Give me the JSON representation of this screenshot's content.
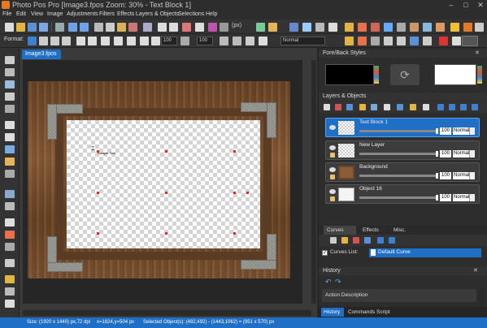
{
  "window": {
    "title": "Photo Pos Pro [Image3.fpos Zoom: 30% - Text Block 1]",
    "controls": {
      "minimize": "–",
      "maximize": "□",
      "close": "✕"
    }
  },
  "menu": [
    "File",
    "Edit",
    "View",
    "Image",
    "Adjustments",
    "Filters",
    "Effects",
    "Layers & Objects",
    "Selections",
    "Help"
  ],
  "toolbar": {
    "units": "(px)",
    "format_label": "Format:",
    "opacity_1": "100",
    "opacity_2": "100",
    "blend_mode": "Normal"
  },
  "document": {
    "tab": "Image3.fpos"
  },
  "canvas": {
    "text_block_preview": "Sample Text"
  },
  "status": {
    "size": "Size: (1920 x 1440) px,72 dpi",
    "coords": "x=1824,y=504 px",
    "selection": "Selected Object(s): (492,492) - (1443,1062) = (951 x 570) px"
  },
  "panels": {
    "fore_back": {
      "title": "Fore/Back Styles",
      "fore_color": "#000000",
      "back_color": "#ffffff"
    },
    "layers": {
      "title": "Layers & Objects",
      "items": [
        {
          "name": "Text Block 1",
          "opacity": "100",
          "blend": "Normal",
          "selected": true
        },
        {
          "name": "New Layer",
          "opacity": "100",
          "blend": "Normal",
          "selected": false
        },
        {
          "name": "Background",
          "opacity": "100",
          "blend": "Normal",
          "selected": false
        },
        {
          "name": "Object 16",
          "opacity": "100",
          "blend": "Normal",
          "selected": false
        }
      ]
    },
    "curves": {
      "tabs": [
        "Curves",
        "Effects",
        "Misc."
      ],
      "list_label": "Curves List:",
      "selected_curve": "Default Curve"
    },
    "history": {
      "title": "History",
      "item": "Action Description",
      "bottom_tabs": [
        "History",
        "Commands Script"
      ]
    }
  },
  "colors": {
    "accent": "#1f6fc7",
    "selection_handle": "#ff1e1e",
    "bracket_metal": "#9a9a95",
    "wood": "#7a5030"
  }
}
